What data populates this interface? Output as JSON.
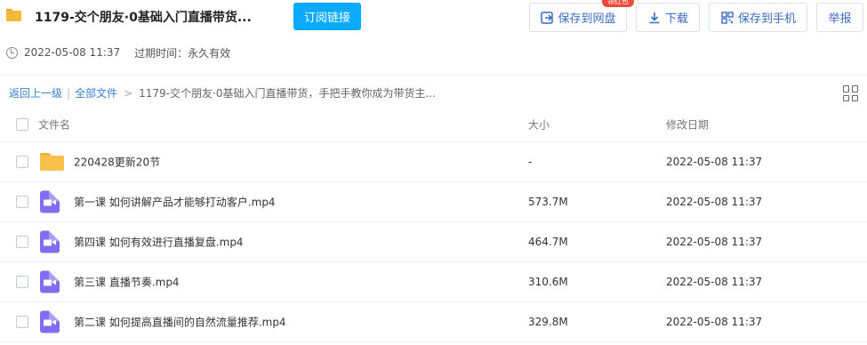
{
  "header": {
    "title": "1179-交个朋友·0基础入门直播带货...",
    "subscribe_label": "订阅链接",
    "save_label": "保存到网盘",
    "download_label": "下载",
    "save_phone_label": "保存到手机",
    "report_label": "举报",
    "badge_label": "领红包"
  },
  "meta": {
    "date": "2022-05-08 11:37",
    "expire": "过期时间：永久有效"
  },
  "breadcrumb": {
    "back": "返回上一级",
    "sep": "|",
    "all_files": "全部文件",
    "arrow": ">",
    "current": "1179-交个朋友·0基础入门直播带货，手把手教你成为带货主..."
  },
  "table": {
    "headers": {
      "name": "文件名",
      "size": "大小",
      "date": "修改日期"
    },
    "rows": [
      {
        "name": "220428更新20节",
        "size": "-",
        "date": "2022-05-08 11:37",
        "type": "folder"
      },
      {
        "name": "第一课 如何讲解产品才能够打动客户.mp4",
        "size": "573.7M",
        "date": "2022-05-08 11:37",
        "type": "video"
      },
      {
        "name": "第四课 如何有效进行直播复盘.mp4",
        "size": "464.7M",
        "date": "2022-05-08 11:37",
        "type": "video"
      },
      {
        "name": "第三课 直播节奏.mp4",
        "size": "310.6M",
        "date": "2022-05-08 11:37",
        "type": "video"
      },
      {
        "name": "第二课 如何提高直播间的自然流量推荐.mp4",
        "size": "329.8M",
        "date": "2022-05-08 11:37",
        "type": "video"
      }
    ]
  },
  "colors": {
    "accent": "#09aaff",
    "link": "#3a7fd0",
    "button_text": "#3a6cc1",
    "badge": "#ee4a3a",
    "folder": "#f7c14b",
    "video": "#7f6ef1"
  },
  "icons": [
    "folder-icon",
    "save-to-cloud-icon",
    "download-icon",
    "qr-phone-icon",
    "clock-icon",
    "grid-view-icon",
    "video-file-icon"
  ]
}
